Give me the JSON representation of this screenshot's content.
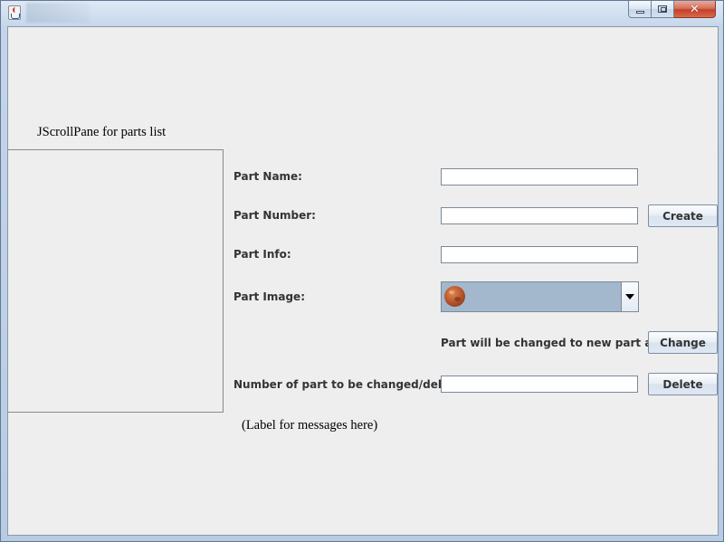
{
  "scroll_pane": {
    "label": "JScrollPane for parts list"
  },
  "messages": {
    "label": "(Label for messages here)"
  },
  "form": {
    "part_name": {
      "label": "Part Name:",
      "value": ""
    },
    "part_number": {
      "label": "Part Number:",
      "value": ""
    },
    "part_info": {
      "label": "Part Info:",
      "value": ""
    },
    "part_image": {
      "label": "Part Image:",
      "selected_icon": "brown-ball-icon"
    },
    "change_note": "Part will be changed to new part above",
    "target_number": {
      "label": "Number of part to be changed/deleted:",
      "value": ""
    }
  },
  "buttons": {
    "create": "Create",
    "change": "Change",
    "delete": "Delete"
  },
  "colors": {
    "panel_bg": "#eeeeee",
    "combo_bg": "#a3b8cc",
    "close_button": "#c44027"
  }
}
